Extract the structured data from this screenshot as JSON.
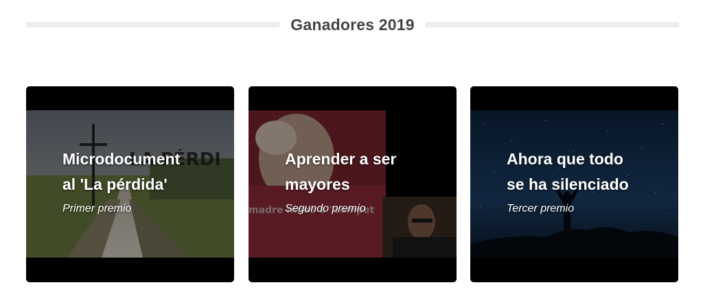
{
  "section": {
    "title": "Ganadores 2019"
  },
  "cards": [
    {
      "title": "Microdocument\nal 'La pérdida'",
      "subtitle": "Primer premio",
      "thumbnail_overlay_text": "LA PÉRDI"
    },
    {
      "title": "Aprender a ser\nmayores",
      "subtitle": "Segundo premio",
      "thumbnail_overlay_text": "madre niños a \"compet"
    },
    {
      "title": "Ahora que todo\nse ha silenciado",
      "subtitle": "Tercer premio"
    }
  ]
}
